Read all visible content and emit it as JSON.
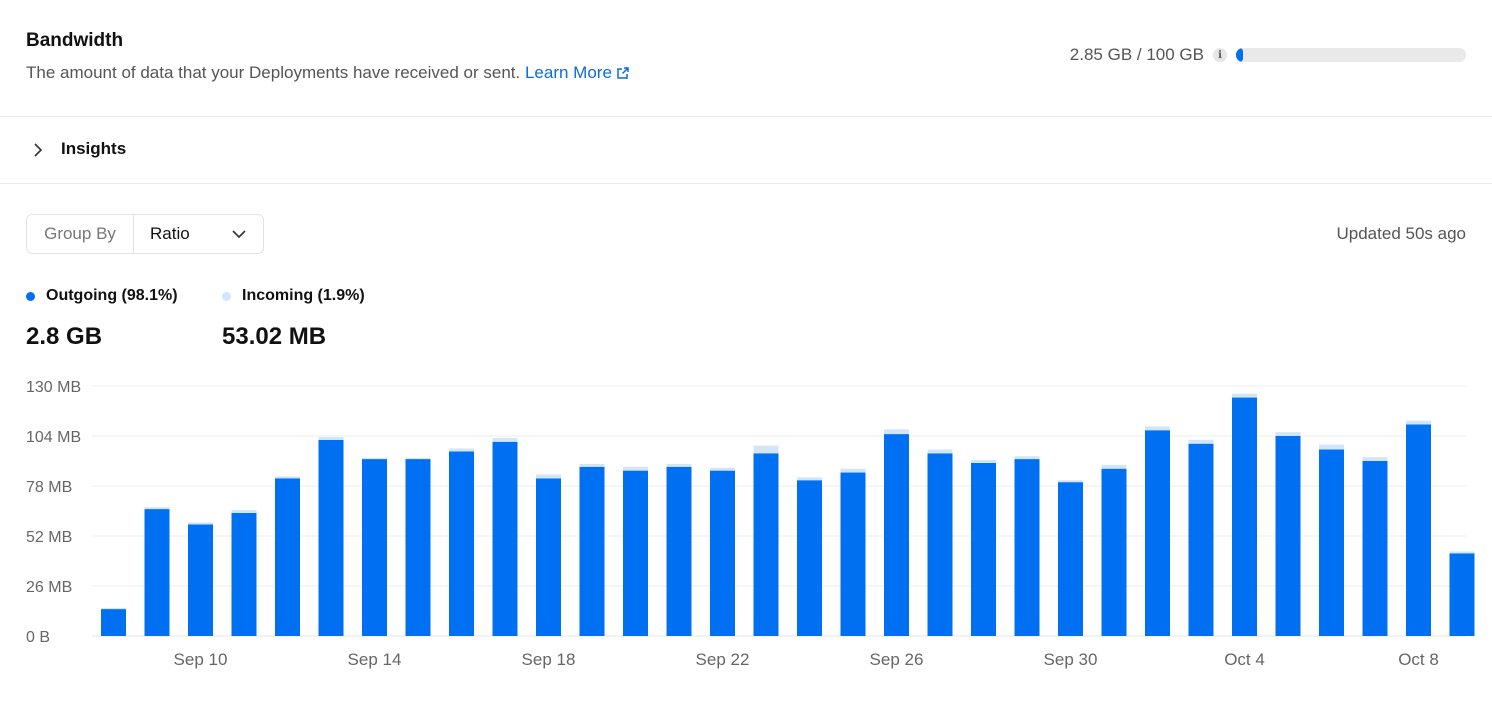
{
  "header": {
    "title": "Bandwidth",
    "description": "The amount of data that your Deployments have received or sent.",
    "learn_more": "Learn More",
    "usage_text": "2.85 GB / 100 GB",
    "usage_fraction": 0.0285,
    "info_icon": "i"
  },
  "insights": {
    "label": "Insights"
  },
  "controls": {
    "group_by_label": "Group By",
    "group_by_value": "Ratio",
    "updated": "Updated 50s ago"
  },
  "legend": {
    "outgoing": {
      "label": "Outgoing (98.1%)",
      "value": "2.8 GB"
    },
    "incoming": {
      "label": "Incoming (1.9%)",
      "value": "53.02 MB"
    }
  },
  "colors": {
    "outgoing": "#0070f3",
    "incoming": "#d3e5fb",
    "accent": "#0a6dd9"
  },
  "chart_data": {
    "type": "bar",
    "stacked": true,
    "ylim": [
      0,
      130
    ],
    "yticks": [
      "0 B",
      "26 MB",
      "52 MB",
      "78 MB",
      "104 MB",
      "130 MB"
    ],
    "xtick_labels": [
      {
        "index": 2,
        "label": "Sep 10"
      },
      {
        "index": 6,
        "label": "Sep 14"
      },
      {
        "index": 10,
        "label": "Sep 18"
      },
      {
        "index": 14,
        "label": "Sep 22"
      },
      {
        "index": 18,
        "label": "Sep 26"
      },
      {
        "index": 22,
        "label": "Sep 30"
      },
      {
        "index": 26,
        "label": "Oct 4"
      },
      {
        "index": 30,
        "label": "Oct 8"
      }
    ],
    "series": [
      {
        "name": "Outgoing",
        "values": [
          14,
          66,
          58,
          64,
          82,
          102,
          92,
          92,
          96,
          101,
          82,
          88,
          86,
          88,
          86,
          95,
          81,
          85,
          105,
          95,
          90,
          92,
          80,
          87,
          107,
          100,
          124,
          104,
          97,
          91,
          110,
          43
        ]
      },
      {
        "name": "Incoming",
        "values": [
          0.5,
          1,
          1,
          1.5,
          1,
          1.5,
          0.5,
          0.5,
          1.5,
          2,
          2,
          1.5,
          2,
          1.5,
          1.5,
          4,
          1.5,
          2,
          2.5,
          2,
          1.5,
          1.5,
          1,
          2,
          2,
          2,
          2,
          2,
          2.5,
          2,
          2,
          1
        ]
      }
    ]
  }
}
